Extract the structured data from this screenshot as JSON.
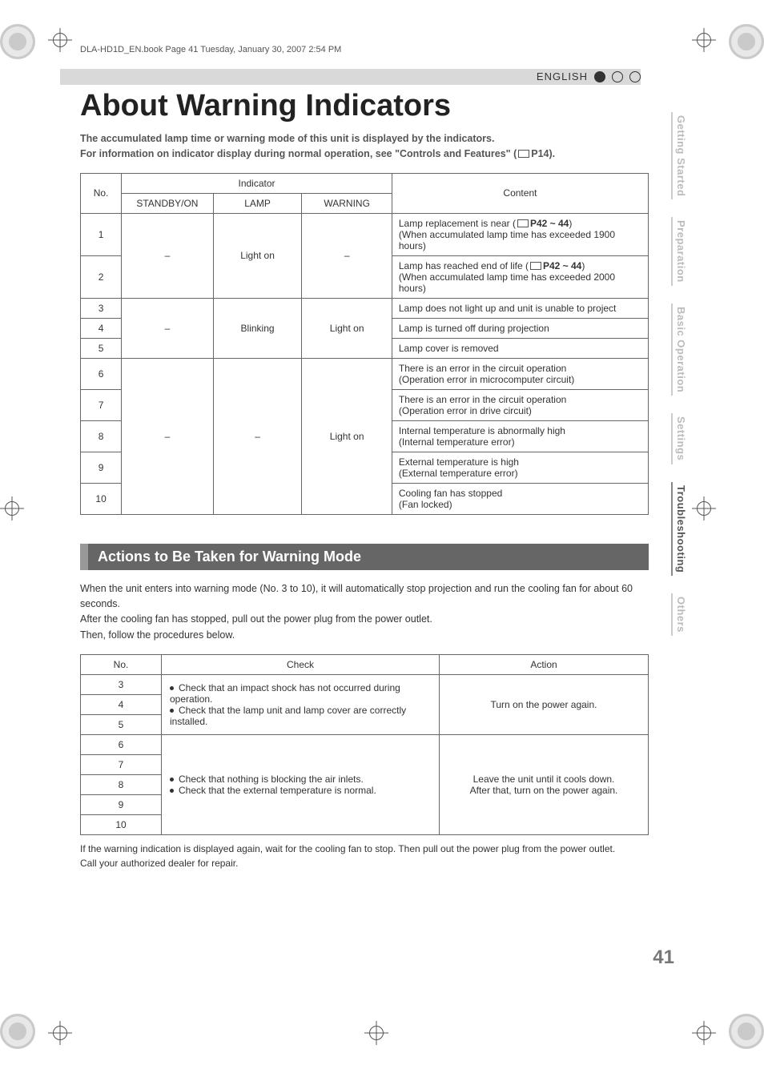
{
  "header_line": "DLA-HD1D_EN.book  Page 41  Tuesday, January 30, 2007  2:54 PM",
  "language_label": "ENGLISH",
  "title": "About Warning Indicators",
  "intro_line1": "The accumulated lamp time or warning mode of this unit is displayed by the indicators.",
  "intro_line2_a": "For information on indicator display during normal operation, see \"Controls and Features\" (",
  "intro_line2_b": "P14).",
  "table1": {
    "headers": {
      "no": "No.",
      "indicator": "Indicator",
      "standby": "STANDBY/ON",
      "lamp": "LAMP",
      "warning": "WARNING",
      "content": "Content"
    },
    "groups": {
      "g1": {
        "standby": "–",
        "lamp": "Light on",
        "warning": "–"
      },
      "g2": {
        "standby": "–",
        "lamp": "Blinking",
        "warning": "Light on"
      },
      "g3": {
        "standby": "–",
        "lamp": "–",
        "warning": "Light on"
      }
    },
    "rows": [
      {
        "no": "1",
        "content_a": "Lamp replacement is near (",
        "content_ref": "P42 ~ 44",
        "content_b": ")",
        "content2": "(When accumulated lamp time has exceeded 1900 hours)"
      },
      {
        "no": "2",
        "content_a": "Lamp has reached end of life (",
        "content_ref": "P42 ~ 44",
        "content_b": ")",
        "content2": "(When accumulated lamp time has exceeded 2000 hours)"
      },
      {
        "no": "3",
        "content": "Lamp does not light up and unit is unable to project"
      },
      {
        "no": "4",
        "content": "Lamp is turned off during projection"
      },
      {
        "no": "5",
        "content": "Lamp cover is removed"
      },
      {
        "no": "6",
        "content": "There is an error in the circuit operation",
        "content2": "(Operation error in microcomputer circuit)"
      },
      {
        "no": "7",
        "content": "There is an error in the circuit operation",
        "content2": "(Operation error in drive circuit)"
      },
      {
        "no": "8",
        "content": "Internal temperature is abnormally high",
        "content2": "(Internal temperature error)"
      },
      {
        "no": "9",
        "content": "External temperature is high",
        "content2": "(External temperature error)"
      },
      {
        "no": "10",
        "content": "Cooling fan has stopped",
        "content2": "(Fan locked)"
      }
    ]
  },
  "section_bar": "Actions to Be Taken for Warning Mode",
  "body1": "When the unit enters into warning mode (No. 3 to 10), it will automatically stop projection and run the cooling fan for about 60 seconds.",
  "body2": "After the cooling fan has stopped, pull out the power plug from the power outlet.",
  "body3": "Then, follow the procedures below.",
  "table2": {
    "headers": {
      "no": "No.",
      "check": "Check",
      "action": "Action"
    },
    "check1a": "Check that an impact shock has not occurred during operation.",
    "check1b": "Check that the lamp unit and lamp cover are correctly installed.",
    "action1": "Turn on the power again.",
    "check2a": "Check that nothing is blocking the air inlets.",
    "check2b": "Check that the external temperature is normal.",
    "action2a": "Leave the unit until it cools down.",
    "action2b": "After that, turn on the power again.",
    "nos": [
      "3",
      "4",
      "5",
      "6",
      "7",
      "8",
      "9",
      "10"
    ]
  },
  "foot1": "If the warning indication is displayed again, wait for the cooling fan to stop. Then pull out the power plug from the power outlet.",
  "foot2": "Call your authorized dealer for repair.",
  "page_number": "41",
  "tabs": {
    "t1": "Getting Started",
    "t2": "Preparation",
    "t3": "Basic Operation",
    "t4": "Settings",
    "t5": "Troubleshooting",
    "t6": "Others"
  }
}
